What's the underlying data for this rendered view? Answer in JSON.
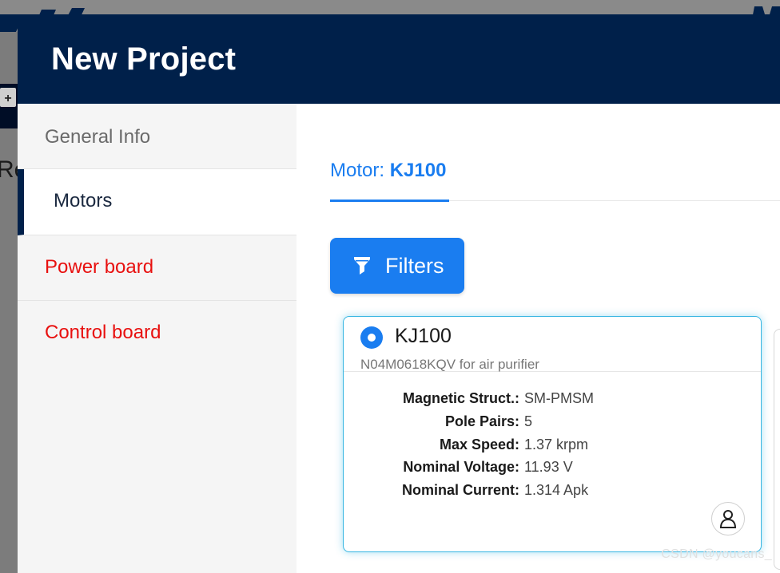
{
  "modal": {
    "title": "New Project"
  },
  "sidebar": {
    "items": [
      {
        "label": "General Info",
        "state": "default"
      },
      {
        "label": "Motors",
        "state": "active"
      },
      {
        "label": "Power board",
        "state": "warning"
      },
      {
        "label": "Control board",
        "state": "warning"
      }
    ]
  },
  "tab": {
    "prefix": "Motor: ",
    "value": "KJ100"
  },
  "filters": {
    "label": "Filters",
    "icon": "funnel-icon"
  },
  "motor_card": {
    "name": "KJ100",
    "description": "N04M0618KQV for air purifier",
    "selected": true,
    "specs": [
      {
        "label": "Magnetic Struct.:",
        "value": "SM-PMSM"
      },
      {
        "label": "Pole Pairs:",
        "value": "5"
      },
      {
        "label": "Max Speed:",
        "value": "1.37 krpm"
      },
      {
        "label": "Nominal Voltage:",
        "value": "11.93 V"
      },
      {
        "label": "Nominal Current:",
        "value": "1.314 Apk"
      }
    ],
    "action_icon": "user-icon"
  },
  "background": {
    "fragment_text": "Re"
  },
  "watermark": "CSDN @youcans_",
  "colors": {
    "header_bg": "#00204a",
    "accent": "#1a7df0",
    "warning_text": "#e8100f",
    "card_border": "#38b6e2"
  }
}
